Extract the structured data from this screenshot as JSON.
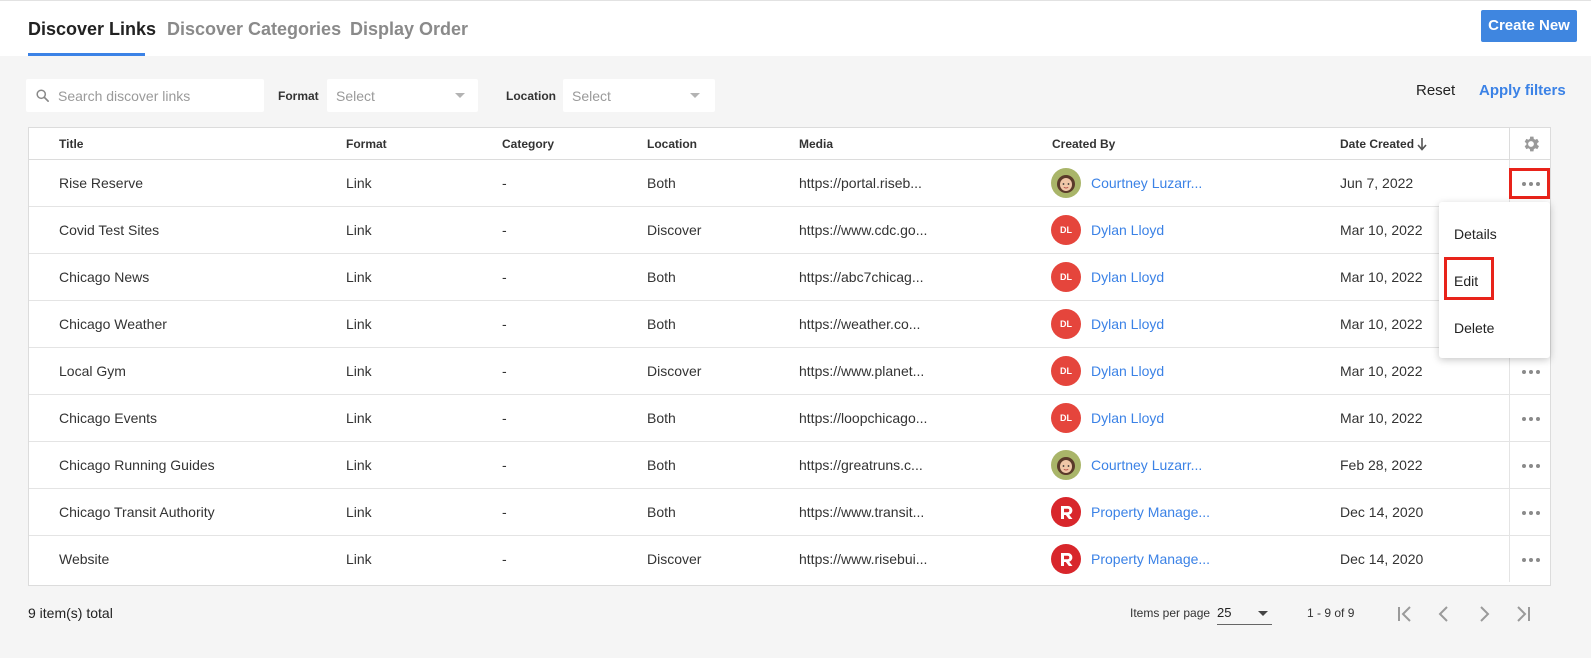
{
  "tabs": [
    {
      "label": "Discover Links",
      "active": true
    },
    {
      "label": "Discover Categories",
      "active": false
    },
    {
      "label": "Display Order",
      "active": false
    }
  ],
  "create_new_label": "Create New",
  "filters": {
    "search_placeholder": "Search discover links",
    "format_label": "Format",
    "format_value": "Select",
    "location_label": "Location",
    "location_value": "Select",
    "reset_label": "Reset",
    "apply_label": "Apply filters"
  },
  "table": {
    "columns": [
      "Title",
      "Format",
      "Category",
      "Location",
      "Media",
      "Created By",
      "Date Created"
    ],
    "sorted_by": "Date Created",
    "rows": [
      {
        "title": "Rise Reserve",
        "format": "Link",
        "category": "-",
        "location": "Both",
        "media": "https://portal.riseb...",
        "created_by": "Courtney Luzarr...",
        "avatar": "photo",
        "date": "Jun 7, 2022"
      },
      {
        "title": "Covid Test Sites",
        "format": "Link",
        "category": "-",
        "location": "Discover",
        "media": "https://www.cdc.go...",
        "created_by": "Dylan Lloyd",
        "avatar": "DL",
        "date": "Mar 10, 2022"
      },
      {
        "title": "Chicago News",
        "format": "Link",
        "category": "-",
        "location": "Both",
        "media": "https://abc7chicag...",
        "created_by": "Dylan Lloyd",
        "avatar": "DL",
        "date": "Mar 10, 2022"
      },
      {
        "title": "Chicago Weather",
        "format": "Link",
        "category": "-",
        "location": "Both",
        "media": "https://weather.co...",
        "created_by": "Dylan Lloyd",
        "avatar": "DL",
        "date": "Mar 10, 2022"
      },
      {
        "title": "Local Gym",
        "format": "Link",
        "category": "-",
        "location": "Discover",
        "media": "https://www.planet...",
        "created_by": "Dylan Lloyd",
        "avatar": "DL",
        "date": "Mar 10, 2022"
      },
      {
        "title": "Chicago Events",
        "format": "Link",
        "category": "-",
        "location": "Both",
        "media": "https://loopchicago...",
        "created_by": "Dylan Lloyd",
        "avatar": "DL",
        "date": "Mar 10, 2022"
      },
      {
        "title": "Chicago Running Guides",
        "format": "Link",
        "category": "-",
        "location": "Both",
        "media": "https://greatruns.c...",
        "created_by": "Courtney Luzarr...",
        "avatar": "photo",
        "date": "Feb 28, 2022"
      },
      {
        "title": "Chicago Transit Authority",
        "format": "Link",
        "category": "-",
        "location": "Both",
        "media": "https://www.transit...",
        "created_by": "Property Manage...",
        "avatar": "rise",
        "date": "Dec 14, 2020"
      },
      {
        "title": "Website",
        "format": "Link",
        "category": "-",
        "location": "Discover",
        "media": "https://www.risebui...",
        "created_by": "Property Manage...",
        "avatar": "rise",
        "date": "Dec 14, 2020"
      }
    ]
  },
  "row_menu": {
    "open_on_row": 0,
    "items": [
      "Details",
      "Edit",
      "Delete"
    ],
    "highlighted_item": "Edit"
  },
  "footer": {
    "total_text": "9 item(s) total",
    "items_per_page_label": "Items per page",
    "items_per_page_value": "25",
    "range_text": "1 - 9 of 9"
  },
  "colors": {
    "accent": "#3b82e6",
    "button": "#3f86e0",
    "highlight": "#e8231a",
    "avatar_dl": "#e5453c"
  },
  "icons": {
    "search": "search-icon",
    "settings": "gear-icon",
    "sort": "arrow-down-icon",
    "row_actions": "more-horizontal-icon",
    "pagination": [
      "first-page-icon",
      "previous-page-icon",
      "next-page-icon",
      "last-page-icon"
    ]
  }
}
